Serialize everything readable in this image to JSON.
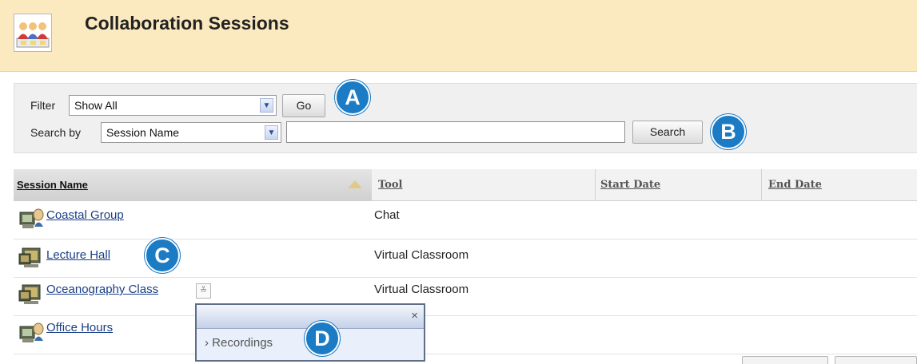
{
  "header": {
    "title": "Collaboration Sessions",
    "icon": "people-group-icon"
  },
  "filter": {
    "label": "Filter",
    "selected": "Show All",
    "go_label": "Go"
  },
  "search": {
    "label": "Search by",
    "selected": "Session Name",
    "value": "",
    "button_label": "Search"
  },
  "callouts": {
    "a": "A",
    "b": "B",
    "c": "C",
    "d": "D"
  },
  "table": {
    "columns": [
      "Session Name",
      "Tool",
      "Start Date",
      "End Date"
    ],
    "rows": [
      {
        "name": "Coastal Group",
        "tool": "Chat",
        "icon": "chat-session-icon"
      },
      {
        "name": "Lecture Hall",
        "tool": "Virtual Classroom",
        "icon": "classroom-session-icon"
      },
      {
        "name": "Oceanography Class",
        "tool": "Virtual Classroom",
        "icon": "classroom-session-icon"
      },
      {
        "name": "Office Hours",
        "tool": "",
        "icon": "chat-session-icon"
      }
    ]
  },
  "context_menu": {
    "close": "×",
    "item": "Recordings",
    "item_prefix": "›"
  },
  "colors": {
    "header_bg": "#fbe9bf",
    "callout": "#1b7bc4",
    "link": "#1a3e84"
  }
}
